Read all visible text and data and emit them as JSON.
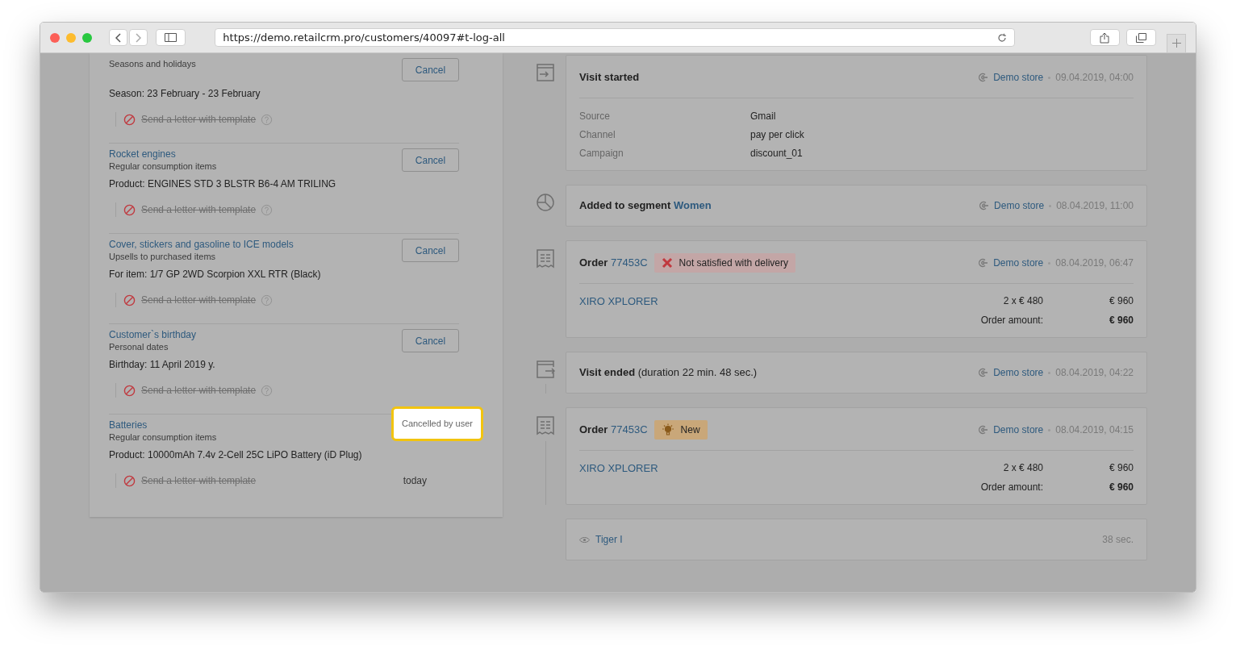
{
  "browser": {
    "url": "https://demo.retailcrm.pro/customers/40097#t-log-all"
  },
  "triggers": [
    {
      "subtitle": "Seasons and holidays",
      "detail": "Season: 23 February - 23 February",
      "action": {
        "label": "Send a letter with template",
        "cancelled": true,
        "help": true
      },
      "status": {
        "kind": "button",
        "label": "Cancel"
      }
    },
    {
      "title": "Rocket engines",
      "subtitle": "Regular consumption items",
      "detail": "Product: ENGINES STD 3 BLSTR B6-4 AM TRILING",
      "action": {
        "label": "Send a letter with template",
        "cancelled": true,
        "help": true
      },
      "status": {
        "kind": "button",
        "label": "Cancel"
      }
    },
    {
      "title": "Cover, stickers and gasoline to ICE models",
      "subtitle": "Upsells to purchased items",
      "detail": "For item: 1/7 GP 2WD Scorpion XXL RTR (Black)",
      "action": {
        "label": "Send a letter with template",
        "cancelled": true,
        "help": true
      },
      "status": {
        "kind": "button",
        "label": "Cancel"
      }
    },
    {
      "title": "Customer`s birthday",
      "subtitle": "Personal dates",
      "detail": "Birthday: 11 April 2019 y.",
      "action": {
        "label": "Send a letter with template",
        "cancelled": true,
        "help": true
      },
      "status": {
        "kind": "button",
        "label": "Cancel"
      }
    },
    {
      "title": "Batteries",
      "subtitle": "Regular consumption items",
      "detail": "Product: 10000mAh 7.4v 2-Cell 25C LiPO Battery (iD Plug)",
      "action": {
        "label": "Send a letter with template",
        "cancelled": true,
        "help": false,
        "date": "today"
      },
      "status": {
        "kind": "callout",
        "label": "Cancelled by user"
      }
    }
  ],
  "events": [
    {
      "kind": "visit_start",
      "title": "Visit started",
      "store": "Demo store",
      "time": "09.04.2019, 04:00",
      "fields": [
        {
          "label": "Source",
          "value": "Gmail"
        },
        {
          "label": "Channel",
          "value": "pay per click"
        },
        {
          "label": "Campaign",
          "value": "discount_01"
        }
      ]
    },
    {
      "kind": "segment",
      "title": "Added to segment",
      "link": "Women",
      "store": "Demo store",
      "time": "08.04.2019, 11:00"
    },
    {
      "kind": "order",
      "title": "Order",
      "link": "77453C",
      "badge": {
        "kind": "cancelled",
        "label": "Not satisfied with delivery"
      },
      "store": "Demo store",
      "time": "08.04.2019, 06:47",
      "product": "XIRO XPLORER",
      "qty": "2 x € 480",
      "price": "€ 960",
      "total_label": "Order amount:",
      "total": "€ 960"
    },
    {
      "kind": "visit_end",
      "title": "Visit ended",
      "note": "(duration 22 min. 48 sec.)",
      "store": "Demo store",
      "time": "08.04.2019, 04:22"
    },
    {
      "kind": "order",
      "title": "Order",
      "link": "77453C",
      "badge": {
        "kind": "new",
        "label": "New"
      },
      "store": "Demo store",
      "time": "08.04.2019, 04:15",
      "product": "XIRO XPLORER",
      "qty": "2 x € 480",
      "price": "€ 960",
      "total_label": "Order amount:",
      "total": "€ 960"
    },
    {
      "kind": "page_view",
      "link": "Tiger I",
      "duration": "38 sec."
    }
  ]
}
